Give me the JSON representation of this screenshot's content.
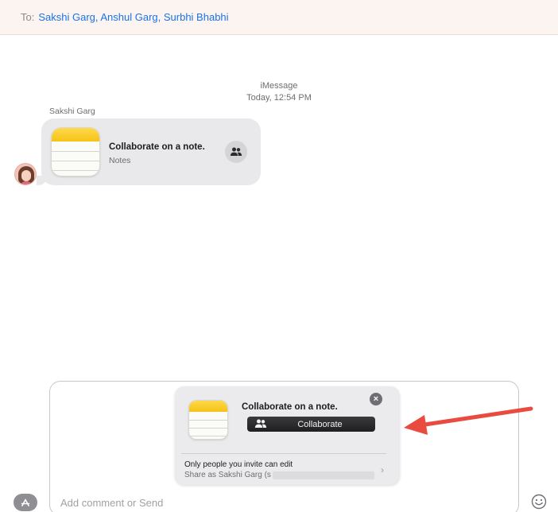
{
  "header": {
    "to_label": "To:",
    "recipients": "Sakshi Garg, Anshul Garg, Surbhi Bhabhi"
  },
  "thread": {
    "service": "iMessage",
    "timestamp": "Today, 12:54 PM"
  },
  "message": {
    "sender": "Sakshi Garg",
    "title": "Collaborate on a note.",
    "subtitle": "Notes"
  },
  "share_card": {
    "title": "Collaborate on a note.",
    "collaborate_label": "Collaborate",
    "permission_text": "Only people you invite can edit",
    "share_as_text": "Share as Sakshi Garg (s"
  },
  "compose": {
    "placeholder": "Add comment or Send"
  },
  "colors": {
    "recipient_link": "#1a73e8",
    "annotation_arrow": "#e94b40"
  }
}
